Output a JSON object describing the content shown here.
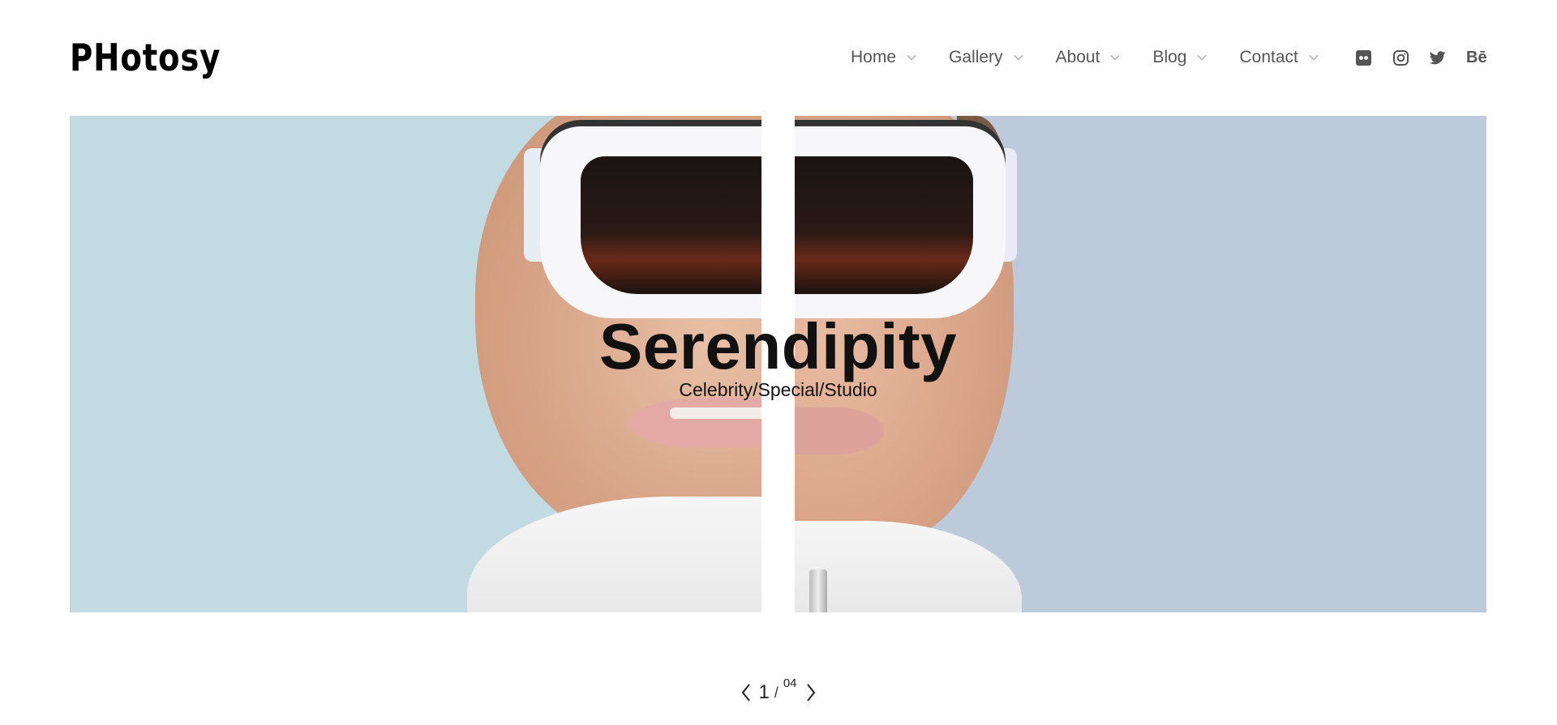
{
  "header": {
    "logo_text": "PHotosy",
    "nav": [
      {
        "label": "Home",
        "icon": "chevron-down-icon"
      },
      {
        "label": "Gallery",
        "icon": "chevron-down-icon"
      },
      {
        "label": "About",
        "icon": "chevron-down-icon"
      },
      {
        "label": "Blog",
        "icon": "chevron-down-icon"
      },
      {
        "label": "Contact",
        "icon": "chevron-down-icon"
      }
    ],
    "socials": [
      {
        "name": "flickr-icon"
      },
      {
        "name": "instagram-icon"
      },
      {
        "name": "twitter-icon"
      },
      {
        "name": "behance-icon",
        "text": "Bē"
      }
    ]
  },
  "hero": {
    "title": "Serendipity",
    "subtitle": "Celebrity/Special/Studio",
    "colors": {
      "left_bg": "#c2dbe3",
      "right_bg": "#bccadb"
    }
  },
  "pager": {
    "current": "1",
    "separator": "/",
    "total": "04",
    "prev_icon": "chevron-left-icon",
    "next_icon": "chevron-right-icon"
  }
}
